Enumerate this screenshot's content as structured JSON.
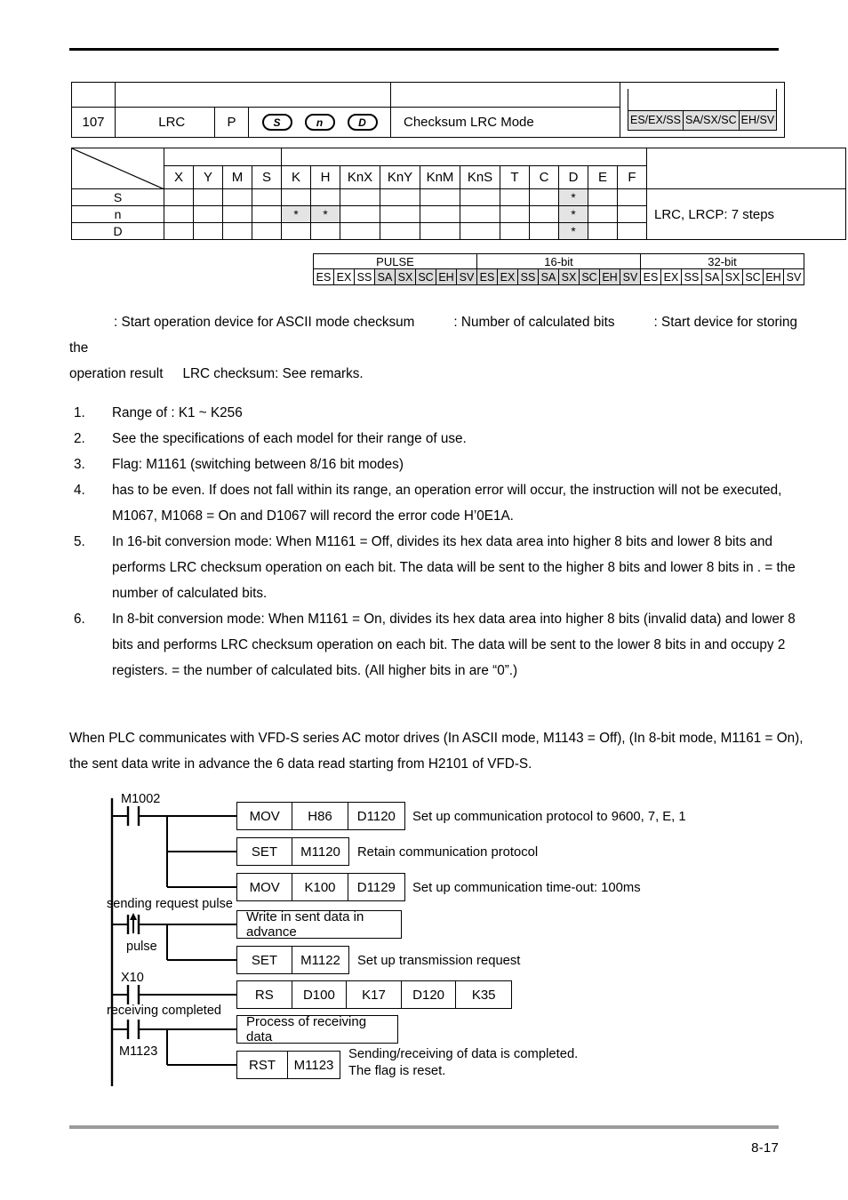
{
  "page": {
    "number": "8-17"
  },
  "instruction": {
    "api_number": "107",
    "mnemonic": "LRC",
    "pulse_flag": "P",
    "operands": [
      "S",
      "n",
      "D"
    ],
    "description": "Checksum LRC Mode",
    "models": [
      "ES/EX/SS",
      "SA/SX/SC",
      "EH/SV"
    ],
    "steps": "LRC, LRCP: 7 steps"
  },
  "device_table": {
    "columns": [
      "X",
      "Y",
      "M",
      "S",
      "K",
      "H",
      "KnX",
      "KnY",
      "KnM",
      "KnS",
      "T",
      "C",
      "D",
      "E",
      "F"
    ],
    "rows": [
      {
        "label": "S",
        "marks": [
          "",
          "",
          "",
          "",
          "",
          "",
          "",
          "",
          "",
          "",
          "",
          "",
          "*",
          "",
          ""
        ]
      },
      {
        "label": "n",
        "marks": [
          "",
          "",
          "",
          "",
          "*",
          "*",
          "",
          "",
          "",
          "",
          "",
          "",
          "*",
          "",
          ""
        ]
      },
      {
        "label": "D",
        "marks": [
          "",
          "",
          "",
          "",
          "",
          "",
          "",
          "",
          "",
          "",
          "",
          "",
          "*",
          "",
          ""
        ]
      }
    ]
  },
  "bits_table": {
    "groups": [
      {
        "title": "PULSE",
        "cells": [
          {
            "label": "ES",
            "shaded": false
          },
          {
            "label": "EX",
            "shaded": false
          },
          {
            "label": "SS",
            "shaded": false
          },
          {
            "label": "SA",
            "shaded": true
          },
          {
            "label": "SX",
            "shaded": true
          },
          {
            "label": "SC",
            "shaded": true
          },
          {
            "label": "EH",
            "shaded": true
          },
          {
            "label": "SV",
            "shaded": true
          }
        ]
      },
      {
        "title": "16-bit",
        "cells": [
          {
            "label": "ES",
            "shaded": true
          },
          {
            "label": "EX",
            "shaded": true
          },
          {
            "label": "SS",
            "shaded": true
          },
          {
            "label": "SA",
            "shaded": true
          },
          {
            "label": "SX",
            "shaded": true
          },
          {
            "label": "SC",
            "shaded": true
          },
          {
            "label": "EH",
            "shaded": true
          },
          {
            "label": "SV",
            "shaded": true
          }
        ]
      },
      {
        "title": "32-bit",
        "cells": [
          {
            "label": "ES",
            "shaded": false
          },
          {
            "label": "EX",
            "shaded": false
          },
          {
            "label": "SS",
            "shaded": false
          },
          {
            "label": "SA",
            "shaded": false
          },
          {
            "label": "SX",
            "shaded": false
          },
          {
            "label": "SC",
            "shaded": false
          },
          {
            "label": "EH",
            "shaded": false
          },
          {
            "label": "SV",
            "shaded": false
          }
        ]
      }
    ]
  },
  "operand_descriptions": {
    "line1_a": ": Start operation device for ASCII mode checksum",
    "line1_b": ": Number of calculated bits",
    "line1_c": ": Start device for storing the",
    "line2_a": "operation result",
    "line2_b": "LRC checksum: See remarks."
  },
  "notes": [
    {
      "num": "1.",
      "text": "Range of   : K1 ~ K256"
    },
    {
      "num": "2.",
      "text": "See the specifications of each model for their range of use."
    },
    {
      "num": "3.",
      "text": "Flag: M1161 (switching between 8/16 bit modes)"
    },
    {
      "num": "4.",
      "text": "    has to be even. If     does not fall within its range, an operation error will occur, the instruction will not be executed, M1067, M1068 = On and D1067 will record the error code H’0E1A."
    },
    {
      "num": "5.",
      "text": "In 16-bit conversion mode: When M1161 = Off,     divides its hex data area into higher 8 bits and lower 8 bits and performs LRC checksum operation on each bit. The data will be sent to the higher 8 bits and lower 8 bits in      .      = the number of calculated bits."
    },
    {
      "num": "6.",
      "text": "In 8-bit conversion mode: When M1161 = On,     divides its hex data area into higher 8 bits (invalid data) and lower 8 bits and performs LRC checksum operation on each bit. The data will be sent to the lower 8 bits in       and occupy 2 registers.      = the number of calculated bits. (All higher bits in      are “0”.)"
    }
  ],
  "plc_paragraph": "When PLC communicates with VFD-S series AC motor drives (In ASCII mode, M1143 = Off), (In 8-bit mode, M1161 = On), the sent data write in advance the 6 data read starting from H2101 of VFD-S.",
  "ladder": {
    "contacts": [
      {
        "name": "M1002",
        "caption": ""
      },
      {
        "name": "pulse",
        "caption": "sending request pulse"
      },
      {
        "name": "X10",
        "caption": ""
      },
      {
        "name": "M1123",
        "caption": "receiving completed"
      }
    ],
    "rungs": [
      {
        "segments": [
          "MOV",
          "H86",
          "D1120"
        ],
        "comment": "Set up communication protocol to 9600, 7, E, 1"
      },
      {
        "segments": [
          "SET",
          "M1120"
        ],
        "comment": "Retain communication protocol"
      },
      {
        "segments": [
          "MOV",
          "K100",
          "D1129"
        ],
        "comment": "Set up communication time-out: 100ms"
      },
      {
        "segments": [
          "Write in sent data in advance"
        ],
        "comment": ""
      },
      {
        "segments": [
          "SET",
          "M1122"
        ],
        "comment": "Set up transmission request"
      },
      {
        "segments": [
          "RS",
          "D100",
          "K17",
          "D120",
          "K35"
        ],
        "comment": ""
      },
      {
        "segments": [
          "Process of receiving data"
        ],
        "comment": ""
      },
      {
        "segments": [
          "RST",
          "M1123"
        ],
        "comment": "Sending/receiving of data is completed.",
        "comment2": "The flag is reset."
      }
    ],
    "labels": {
      "m1002": "M1002",
      "sending_request_pulse": "sending request pulse",
      "pulse": "pulse",
      "x10": "X10",
      "receiving_completed": "receiving completed",
      "m1123": "M1123"
    }
  }
}
